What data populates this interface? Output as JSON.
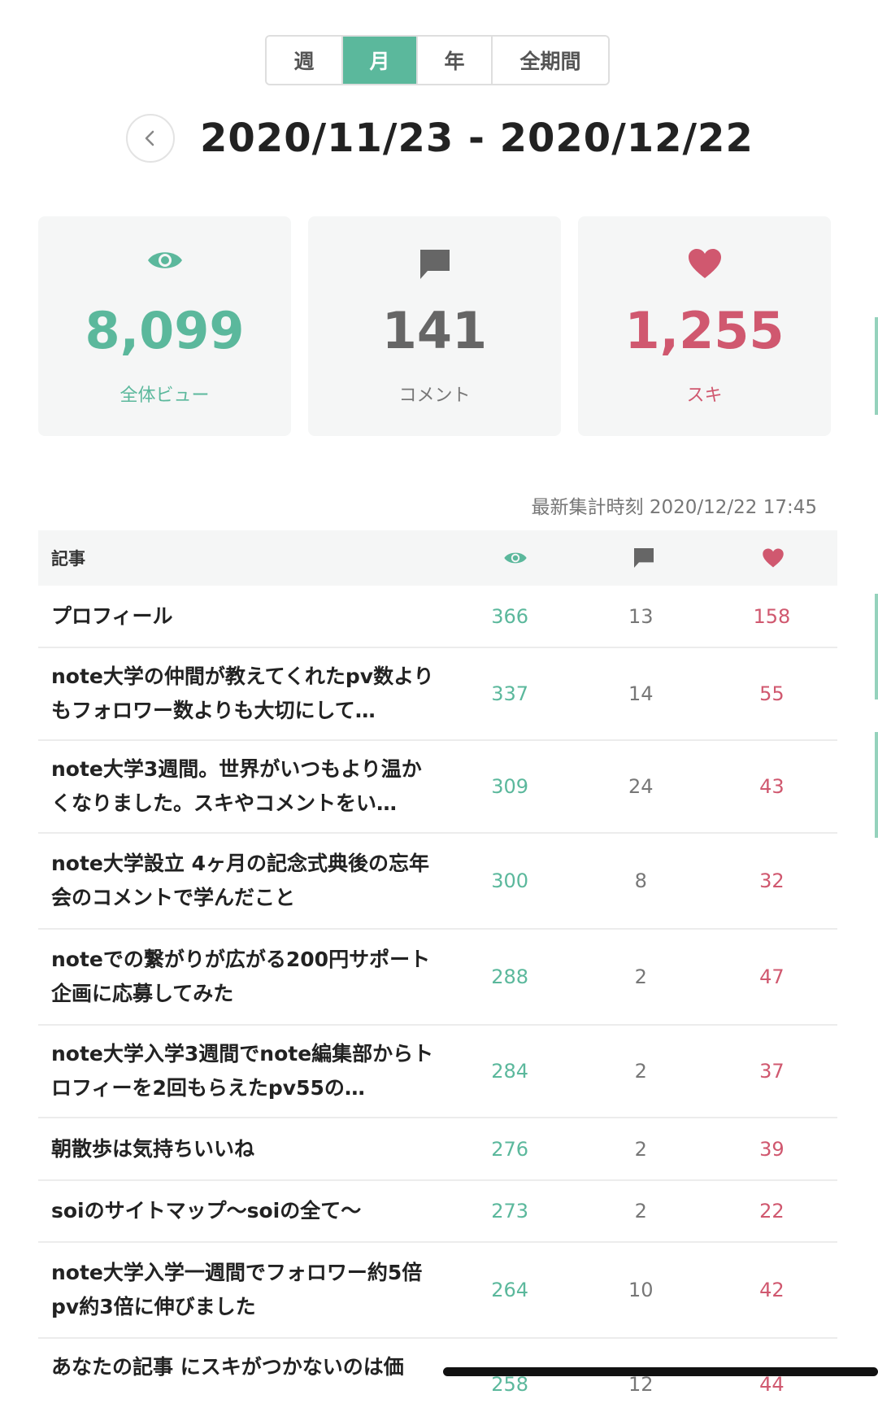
{
  "tabs": [
    {
      "label": "週",
      "active": false
    },
    {
      "label": "月",
      "active": true
    },
    {
      "label": "年",
      "active": false
    },
    {
      "label": "全期間",
      "active": false
    }
  ],
  "date_range": "2020/11/23 - 2020/12/22",
  "stats": {
    "views": {
      "value": "8,099",
      "label": "全体ビュー",
      "color": "#5bb89c",
      "icon": "eye-icon"
    },
    "comments": {
      "value": "141",
      "label": "コメント",
      "color": "#666666",
      "icon": "comment-icon"
    },
    "likes": {
      "value": "1,255",
      "label": "スキ",
      "color": "#d0586f",
      "icon": "heart-icon"
    }
  },
  "updated_at": "最新集計時刻 2020/12/22 17:45",
  "table": {
    "header_title": "記事",
    "rows": [
      {
        "title": "プロフィール",
        "views": "366",
        "comments": "13",
        "likes": "158"
      },
      {
        "title": "note大学の仲間が教えてくれたpv数よりもフォロワー数よりも大切にして…",
        "views": "337",
        "comments": "14",
        "likes": "55"
      },
      {
        "title": "note大学3週間。世界がいつもより温かくなりました。スキやコメントをい…",
        "views": "309",
        "comments": "24",
        "likes": "43"
      },
      {
        "title": "note大学設立 4ヶ月の記念式典後の忘年会のコメントで学んだこと",
        "views": "300",
        "comments": "8",
        "likes": "32"
      },
      {
        "title": "noteでの繋がりが広がる200円サポート企画に応募してみた",
        "views": "288",
        "comments": "2",
        "likes": "47"
      },
      {
        "title": "note大学入学3週間でnote編集部からトロフィーを2回もらえたpv55の…",
        "views": "284",
        "comments": "2",
        "likes": "37"
      },
      {
        "title": "朝散歩は気持ちいいね",
        "views": "276",
        "comments": "2",
        "likes": "39"
      },
      {
        "title": "soiのサイトマップ〜soiの全て〜",
        "views": "273",
        "comments": "2",
        "likes": "22"
      },
      {
        "title": "note大学入学一週間でフォロワー約5倍pv約3倍に伸びました",
        "views": "264",
        "comments": "10",
        "likes": "42"
      },
      {
        "title": "あなたの記事 にスキがつかないのは価",
        "views": "258",
        "comments": "12",
        "likes": "44"
      }
    ]
  }
}
